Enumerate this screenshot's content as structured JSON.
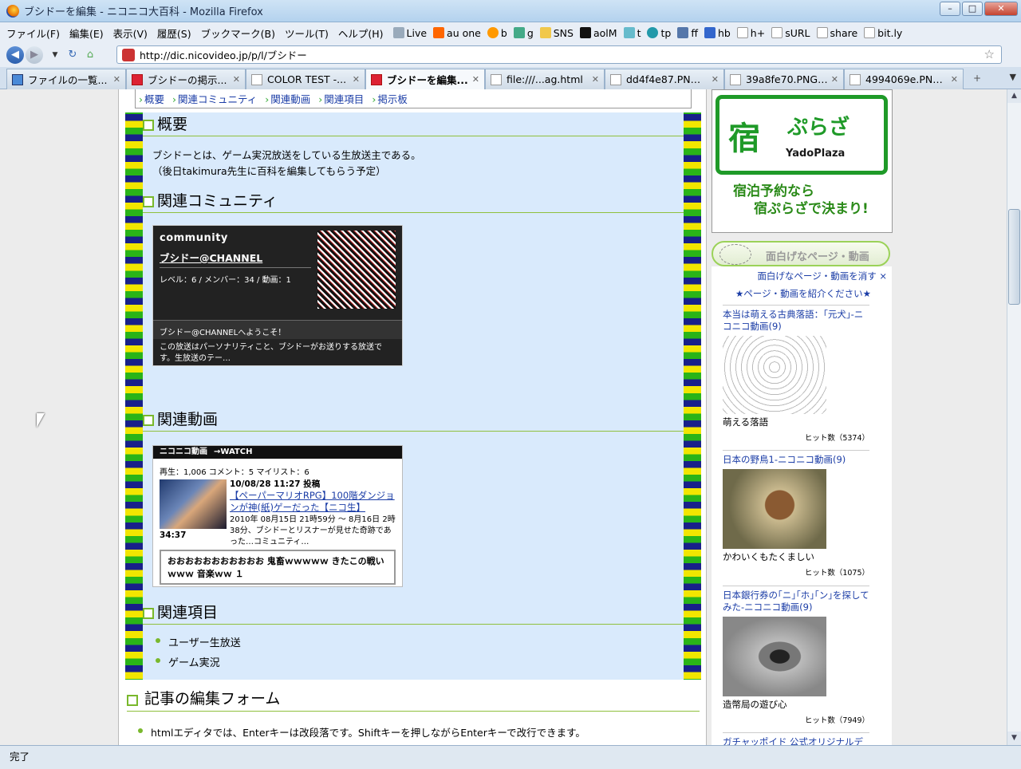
{
  "window": {
    "title": "ブシドーを編集 - ニコニコ大百科 - Mozilla Firefox"
  },
  "menu": {
    "items": [
      "ファイル(F)",
      "編集(E)",
      "表示(V)",
      "履歴(S)",
      "ブックマーク(B)",
      "ツール(T)",
      "ヘルプ(H)"
    ],
    "bookmarks": [
      "Live",
      "au one",
      "b",
      "g",
      "SNS",
      "aolM",
      "t",
      "tp",
      "ff",
      "hb",
      "h+",
      "sURL",
      "share",
      "bit.ly"
    ]
  },
  "nav": {
    "url": "http://dic.nicovideo.jp/p/l/ブシドー"
  },
  "tabs": [
    {
      "label": "ファイルの一覧...",
      "icon": "blue"
    },
    {
      "label": "ブシドーの掲示...",
      "icon": "red"
    },
    {
      "label": "COLOR TEST -...",
      "icon": "page"
    },
    {
      "label": "ブシドーを編集...",
      "icon": "red",
      "active": true
    },
    {
      "label": "file:///...ag.html",
      "icon": "page"
    },
    {
      "label": "dd4f4e87.PNG ...",
      "icon": "page"
    },
    {
      "label": "39a8fe70.PNG ...",
      "icon": "page"
    },
    {
      "label": "4994069e.PNG...",
      "icon": "page"
    }
  ],
  "toc": [
    "概要",
    "関連コミュニティ",
    "関連動画",
    "関連項目",
    "掲示板"
  ],
  "article": {
    "s1_title": "概要",
    "s1_line1": "ブシドーとは、ゲーム実況放送をしている生放送主である。",
    "s1_line2": "（後日takimura先生に百科を編集してもらう予定）",
    "s2_title": "関連コミュニティ",
    "s3_title": "関連動画",
    "s4_title": "関連項目",
    "related": [
      "ユーザー生放送",
      "ゲーム実況"
    ]
  },
  "community": {
    "label": "community",
    "name": "ブシドー@CHANNEL",
    "stats": "レベル：6 / メンバー：34 / 動画：1",
    "welcome": "ブシドー@CHANNELへようこそ！",
    "desc": "この放送はパーソナリティこと、ブシドーがお送りする放送です。生放送のテー…"
  },
  "video": {
    "header": "ニコニコ動画",
    "watch": "→WATCH",
    "stats": "再生：1,006 コメント：5 マイリスト：6",
    "date": "10/08/28 11:27 投稿",
    "title": "【ペーパーマリオRPG】100階ダンジョンが神(紙)ゲーだった【ニコ生】",
    "desc": "2010年 08月15日 21時59分 〜 8月16日 2時38分、ブシドーとリスナーが見せた奇跡であった…コミュニティ…",
    "duration": "34:37",
    "comment": "おおおおおおおおおおお 鬼畜ｗｗｗｗｗ きたこの戦いｗｗｗ 音楽ｗｗ １"
  },
  "editform": {
    "title": "記事の編集フォーム",
    "note": "htmlエディタでは、Enterキーは改段落です。Shiftキーを押しながらEnterキーで改行できます。"
  },
  "ad": {
    "logo": "宿",
    "brand": "ぷらざ",
    "en": "YadoPlaza",
    "slogan1": "宿泊予約なら",
    "slogan2": "宿ぷらざで決まり!"
  },
  "sidebar": {
    "heading": "面白げなページ・動画",
    "hide": "面白げなページ・動画を消す ×",
    "intro": "★ページ・動画を紹介ください★",
    "items": [
      {
        "title": "本当は萌える古典落語：｢元犬｣-ニコニコ動画(9)",
        "caption": "萌える落語",
        "hits": "ヒット数（5374）"
      },
      {
        "title": "日本の野鳥1-ニコニコ動画(9)",
        "caption": "かわいくもたくましい",
        "hits": "ヒット数（1075）"
      },
      {
        "title": "日本銀行券の｢ニ｣｢ホ｣｢ン｣を探してみた-ニコニコ動画(9)",
        "caption": "造幣局の遊び心",
        "hits": "ヒット数（7949）"
      },
      {
        "title": "ガチャッポイド 公式オリジナルデモ"
      }
    ]
  },
  "status": {
    "text": "完了"
  }
}
